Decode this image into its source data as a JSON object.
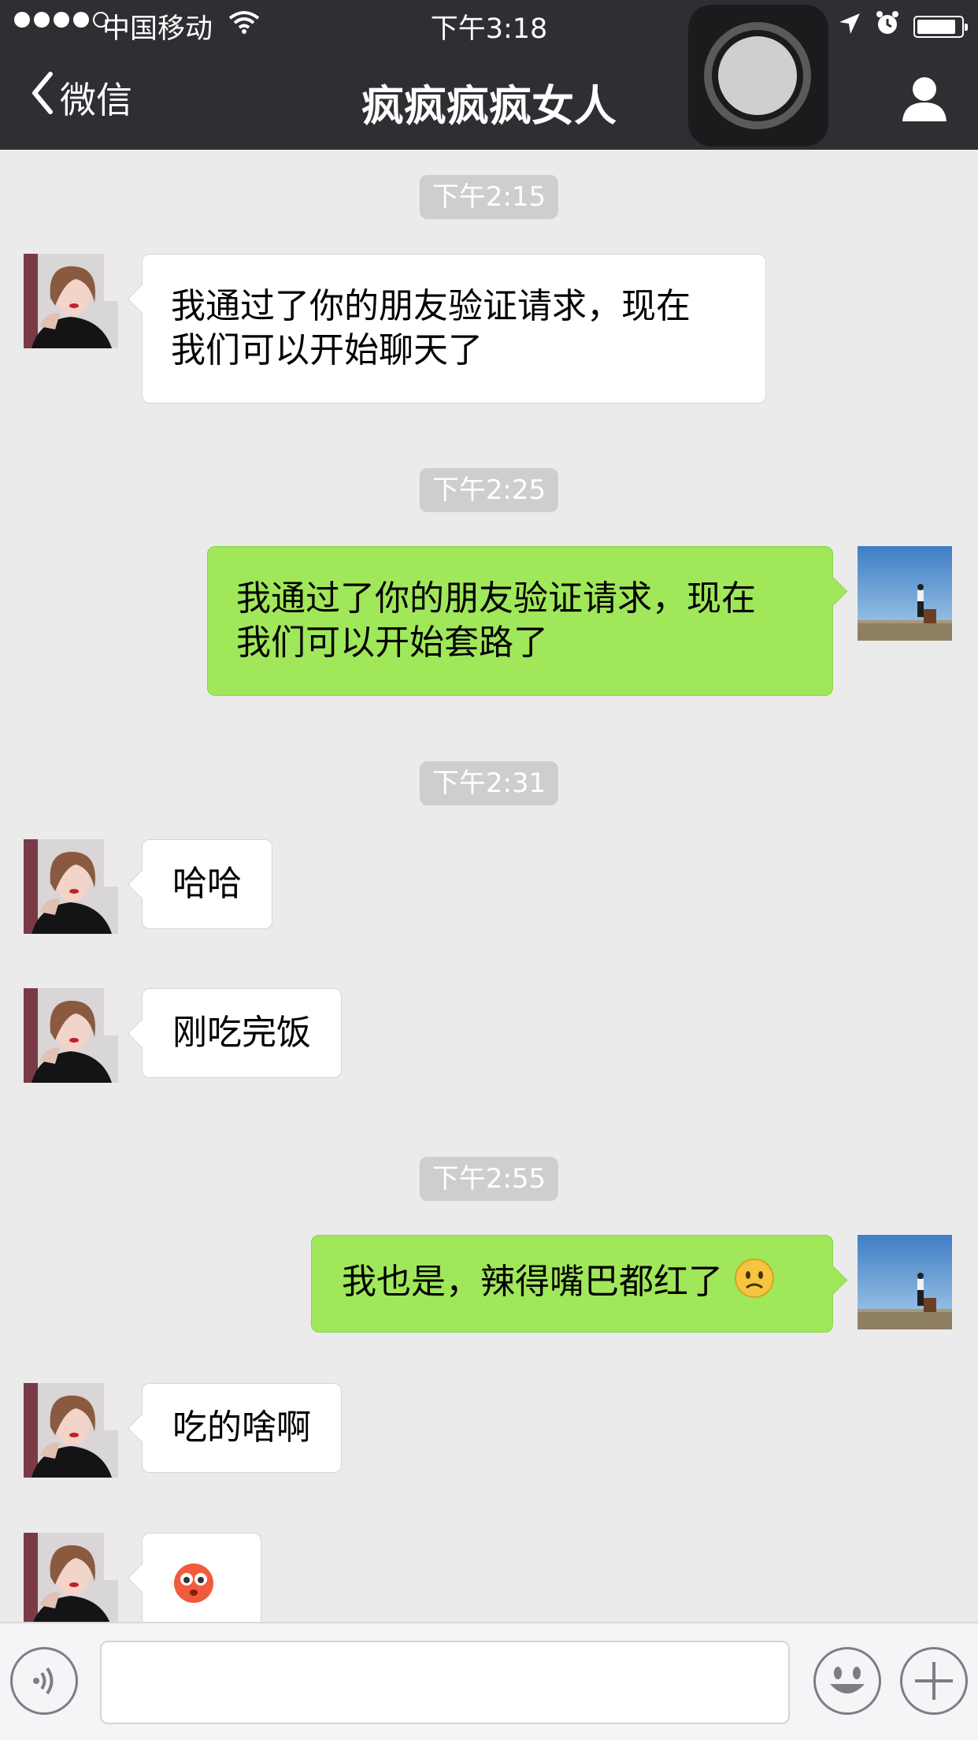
{
  "status_bar": {
    "carrier": "中国移动",
    "time": "下午3:18"
  },
  "navbar": {
    "back_label": "微信",
    "title": "疯疯疯疯女人"
  },
  "messages": [
    {
      "type": "time",
      "text": "下午2:15"
    },
    {
      "type": "in",
      "lines": [
        "我通过了你的朋友验证请求，现在",
        "我们可以开始聊天了"
      ]
    },
    {
      "type": "time",
      "text": "下午2:25"
    },
    {
      "type": "out",
      "lines": [
        "我通过了你的朋友验证请求，现在",
        "我们可以开始套路了"
      ]
    },
    {
      "type": "time",
      "text": "下午2:31"
    },
    {
      "type": "in",
      "text": "哈哈"
    },
    {
      "type": "in",
      "text": "刚吃完饭"
    },
    {
      "type": "time",
      "text": "下午2:55"
    },
    {
      "type": "out",
      "text": "我也是，辣得嘴巴都红了",
      "emoji": "frown-emoji"
    },
    {
      "type": "in",
      "text": "吃的啥啊"
    },
    {
      "type": "in",
      "emoji": "blush-emoji"
    }
  ],
  "colors": {
    "nav_bg": "#2e2e33",
    "chat_bg": "#ebebeb",
    "outgoing_bubble": "#a0e75a",
    "incoming_bubble": "#ffffff",
    "timestamp_bg": "#cecece"
  },
  "icons": {
    "back": "chevron-left-icon",
    "profile": "person-icon",
    "voice": "voice-icon",
    "emoji": "smiley-icon",
    "more": "plus-icon"
  }
}
